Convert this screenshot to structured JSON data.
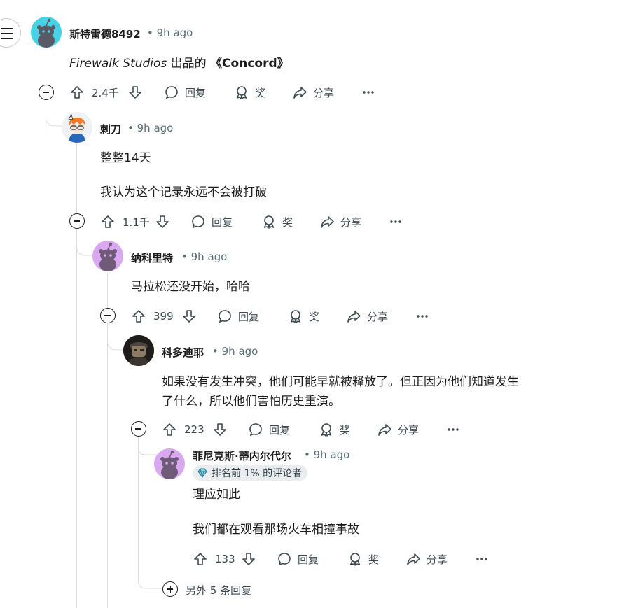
{
  "comments": [
    {
      "user": "斯特雷德8492",
      "time": "9h ago",
      "body_italic": "Firewalk Studios",
      "body_mid": " 出品的 ",
      "body_bold": "《Concord》",
      "votes": "2.4千",
      "reply": "回复",
      "award": "奖",
      "share": "分享"
    },
    {
      "user": "刺刀",
      "time": "9h ago",
      "lines": [
        "整整14天",
        "我认为这个记录永远不会被打破"
      ],
      "votes": "1.1千",
      "reply": "回复",
      "award": "奖",
      "share": "分享"
    },
    {
      "user": "纳科里特",
      "time": "9h ago",
      "lines": [
        "马拉松还没开始，哈哈"
      ],
      "votes": "399",
      "reply": "回复",
      "award": "奖",
      "share": "分享"
    },
    {
      "user": "科多迪耶",
      "time": "9h ago",
      "lines": [
        "如果没有发生冲突，他们可能早就被释放了。但正因为他们知道发生",
        "了什么，所以他们害怕历史重演。"
      ],
      "votes": "223",
      "reply": "回复",
      "award": "奖",
      "share": "分享"
    },
    {
      "user": "菲尼克斯·蒂内尔代尔",
      "time": "9h ago",
      "badge": "排名前 1% 的评论者",
      "lines": [
        "理应如此",
        "我们都在观看那场火车相撞事故"
      ],
      "votes": "133",
      "reply": "回复",
      "award": "奖",
      "share": "分享"
    }
  ],
  "more_replies": "另外 5 条回复",
  "colors": {
    "avatar_cyan": "#46d1e4",
    "avatar_violet": "#d9a8f0",
    "snoo_dark": "#5a5a66"
  }
}
